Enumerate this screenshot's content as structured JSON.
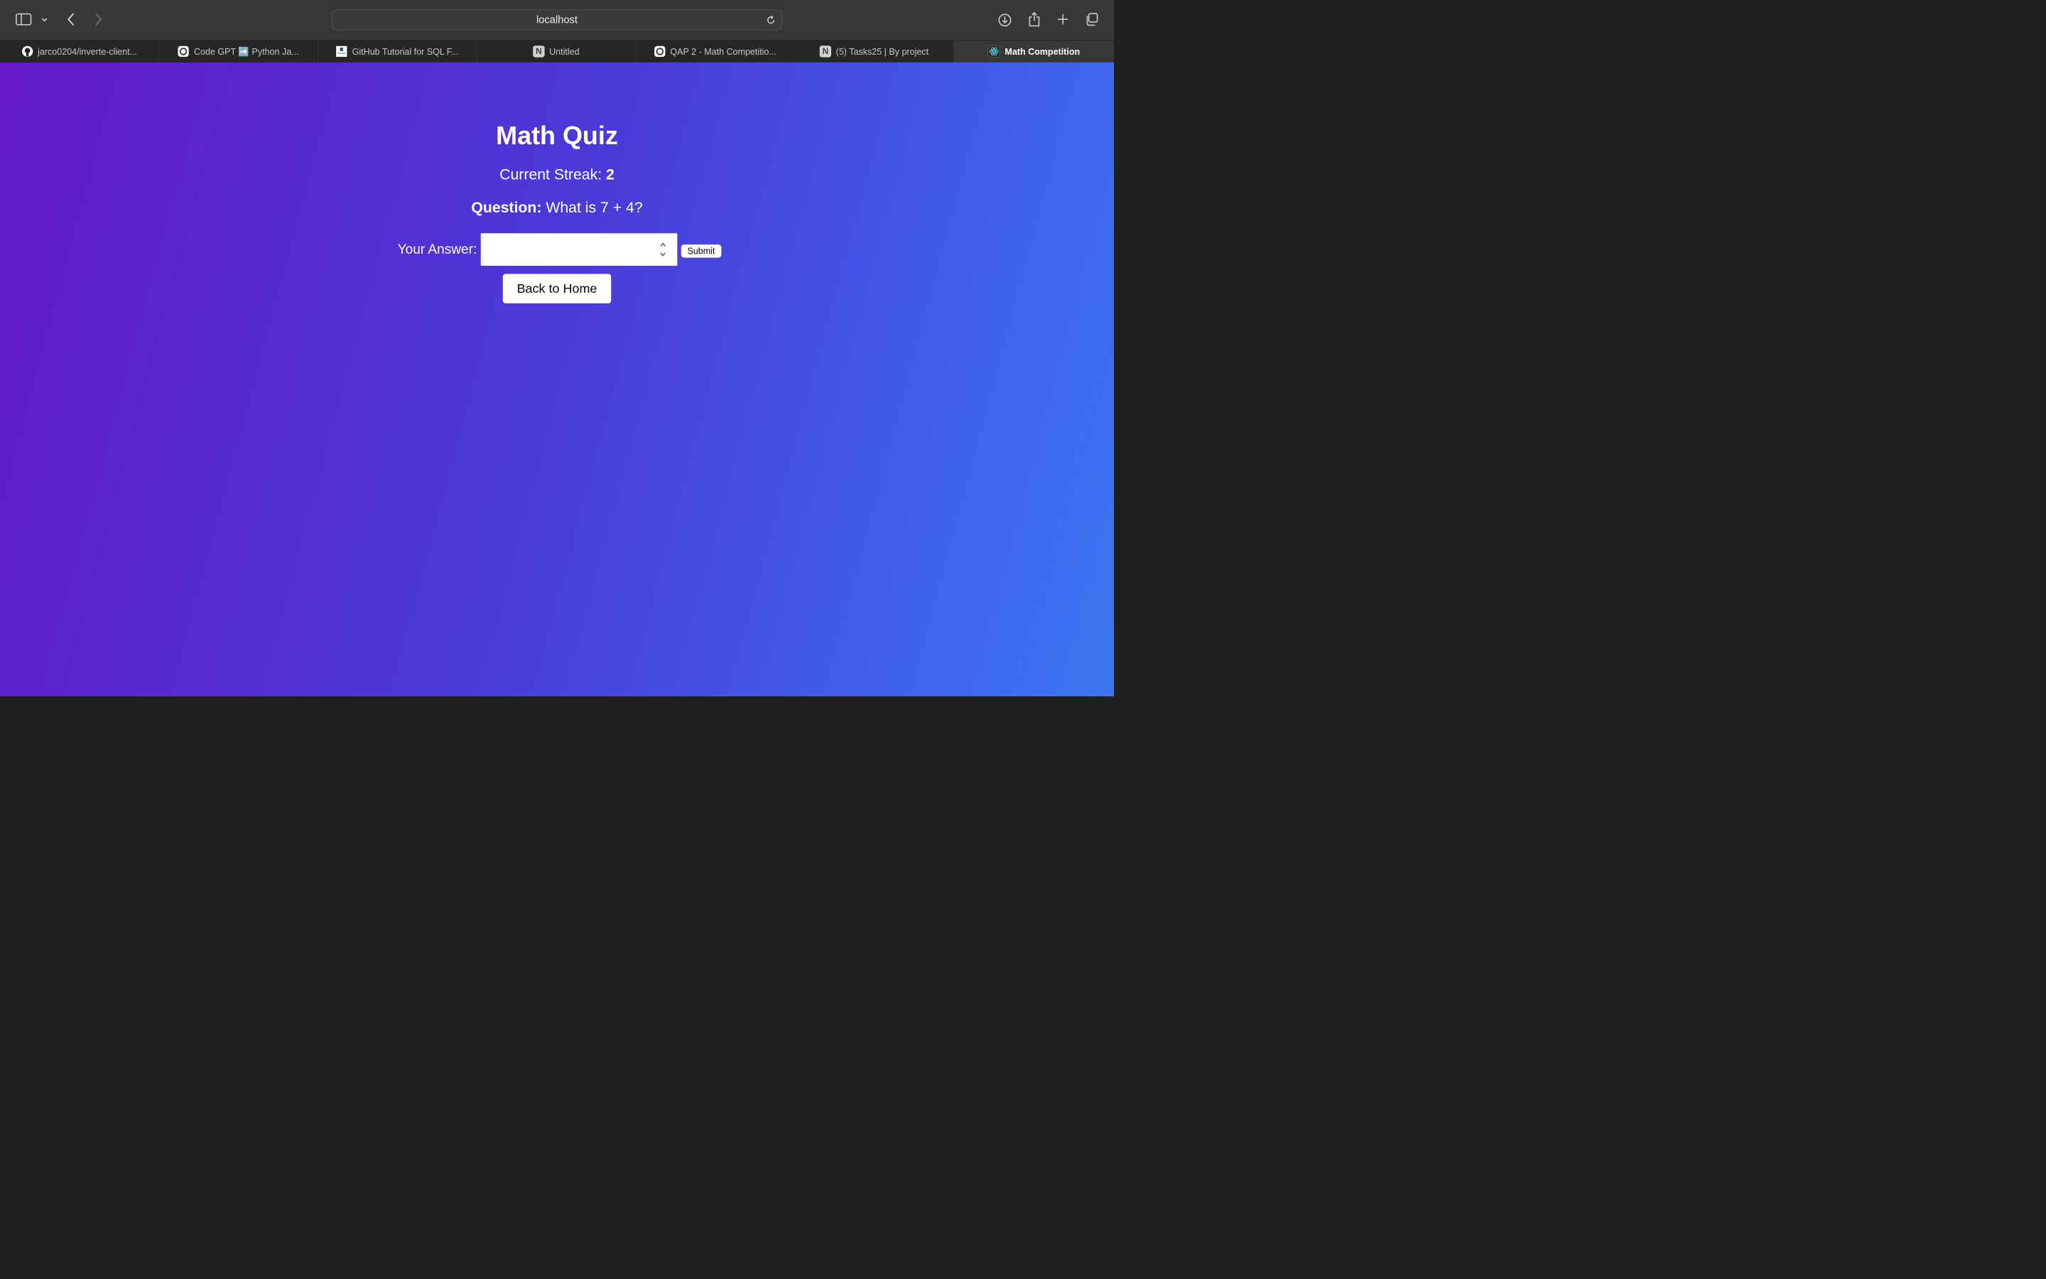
{
  "browser": {
    "url": "localhost",
    "icons": [
      "sidebar-icon",
      "chevron-down-icon",
      "back-icon",
      "forward-icon",
      "reload-icon",
      "download-icon",
      "share-icon",
      "new-tab-icon",
      "tab-overview-icon"
    ],
    "tabs": [
      {
        "label": "jarco0204/inverte-client...",
        "icon": "github-icon"
      },
      {
        "label": "Code GPT ➡️ Python Ja...",
        "icon": "openai-icon"
      },
      {
        "label": "GitHub Tutorial for SQL F...",
        "icon": "site-icon"
      },
      {
        "label": "Untitled",
        "icon": "notion-icon",
        "favicon_text": "N"
      },
      {
        "label": "QAP 2 - Math Competitio...",
        "icon": "openai-icon"
      },
      {
        "label": "(5) Tasks25 | By project",
        "icon": "notion-icon",
        "favicon_text": "N"
      },
      {
        "label": "Math Competition",
        "icon": "react-icon",
        "active": true
      }
    ]
  },
  "quiz": {
    "title": "Math Quiz",
    "streak_label": "Current Streak:",
    "streak_value": "2",
    "question_label": "Question:",
    "question_text": "What is 7 + 4?",
    "answer_label": "Your Answer:",
    "answer_value": "",
    "submit_label": "Submit",
    "home_label": "Back to Home"
  },
  "colors": {
    "gradient_start": "#6418c6",
    "gradient_end": "#3b76f2"
  }
}
